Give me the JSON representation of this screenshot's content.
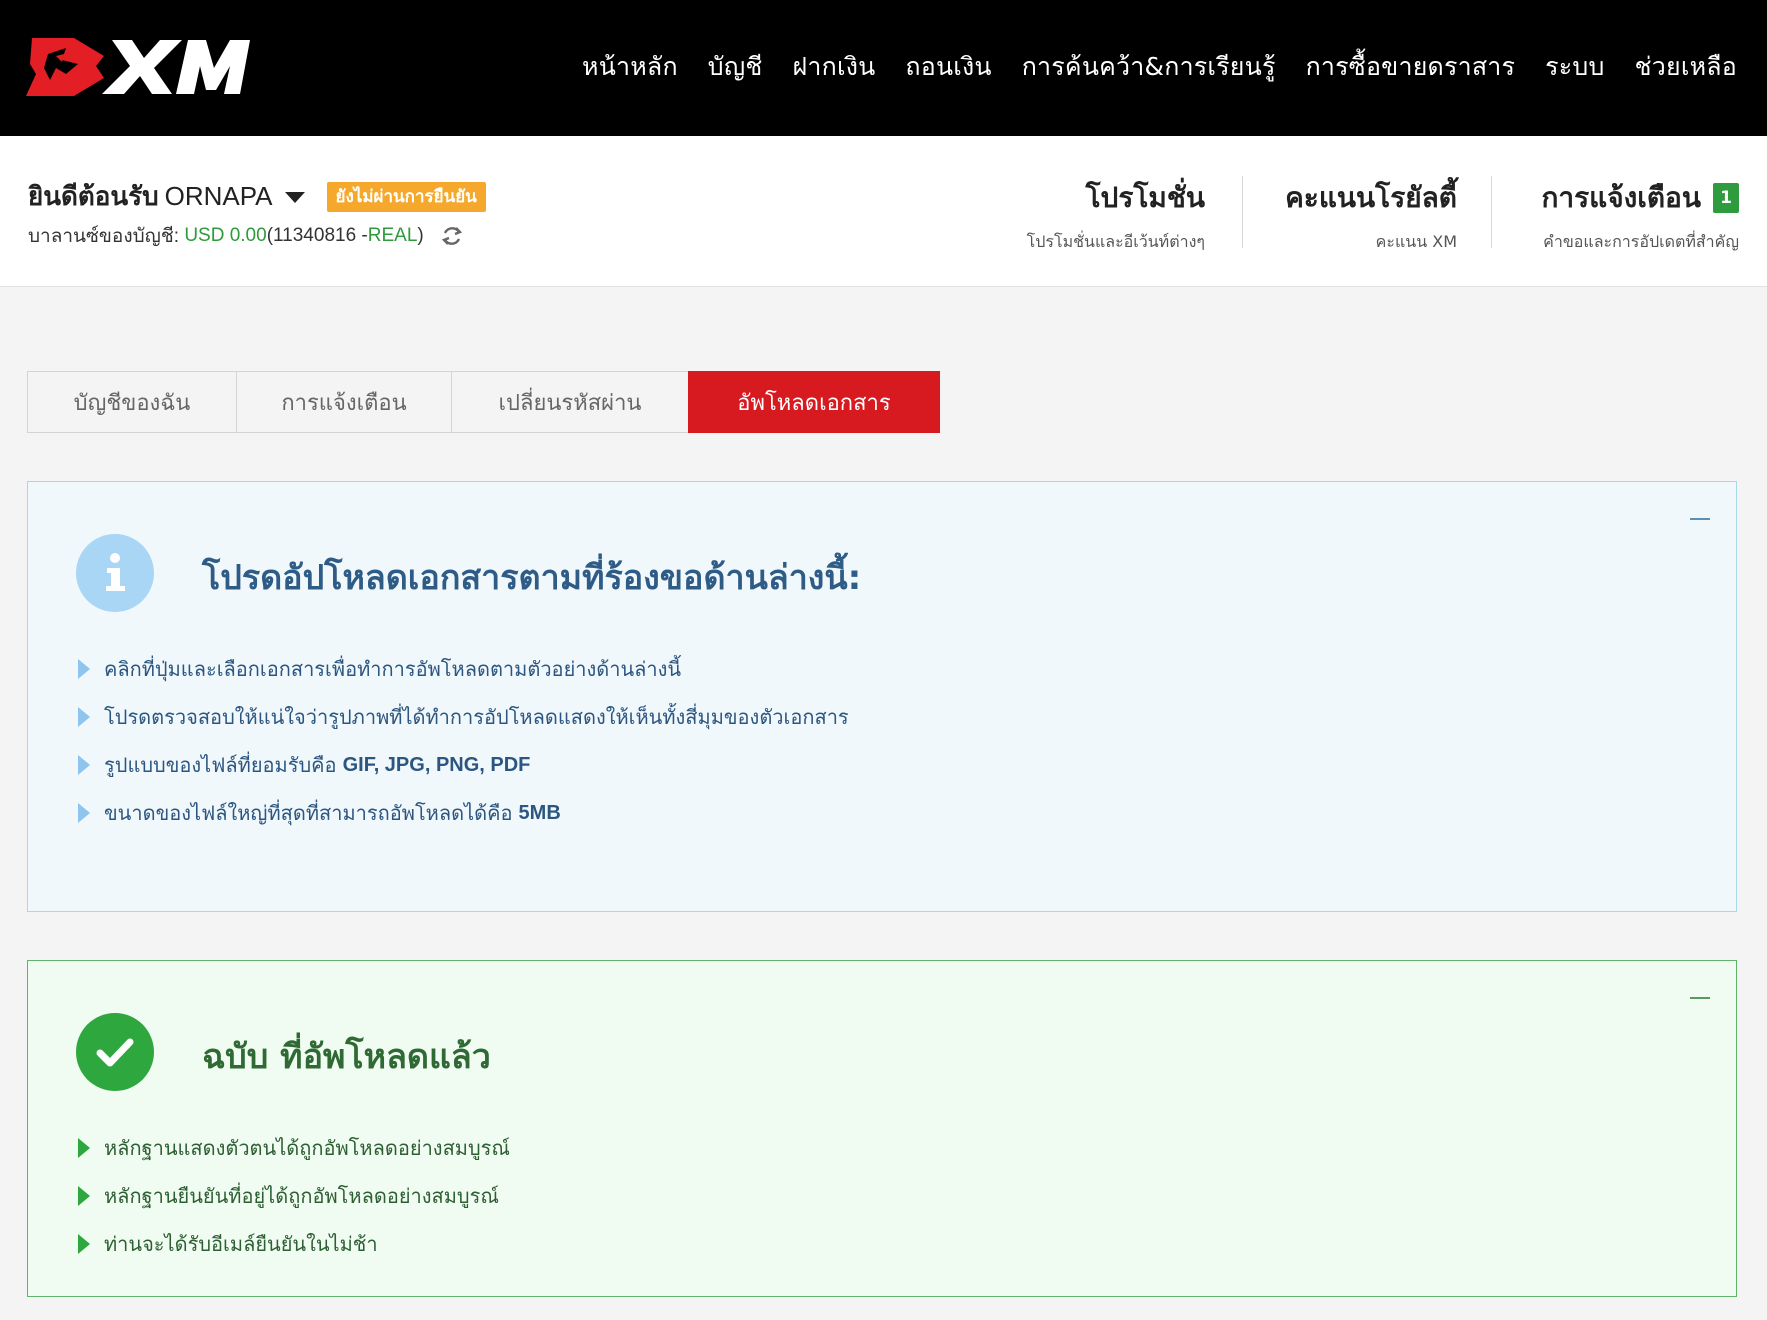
{
  "brand": {
    "name": "XM",
    "red": "#e31e24"
  },
  "nav": [
    {
      "label": "หน้าหลัก"
    },
    {
      "label": "บัญชี"
    },
    {
      "label": "ฝากเงิน"
    },
    {
      "label": "ถอนเงิน"
    },
    {
      "label": "การค้นคว้า&การเรียนรู้"
    },
    {
      "label": "การซื้อขายดราสาร"
    },
    {
      "label": "ระบบ"
    },
    {
      "label": "ช่วยเหลือ"
    }
  ],
  "welcome": {
    "greeting": "ยินดีต้อนรับ",
    "name": "ORNAPA",
    "status_badge": "ยังไม่ผ่านการยืนยัน",
    "balance_label": "บาลานซ์ของบัญชี:",
    "balance_value": "USD 0.00",
    "account_open": " (11340816 - ",
    "account_type": "REAL",
    "account_close": ")"
  },
  "quick_links": [
    {
      "title": "โปรโมชั่น",
      "subtitle": "โปรโมชั่นและอีเว้นท์ต่างๆ"
    },
    {
      "title": "คะแนนโรยัลตี้",
      "subtitle": "คะแนน XM"
    },
    {
      "title": "การแจ้งเตือน",
      "subtitle": "คำขอและการอัปเดตที่สำคัญ",
      "badge": "1"
    }
  ],
  "tabs": [
    {
      "label": "บัญชีของฉัน",
      "active": false
    },
    {
      "label": "การแจ้งเตือน",
      "active": false
    },
    {
      "label": "เปลี่ยนรหัสผ่าน",
      "active": false
    },
    {
      "label": "อัพโหลดเอกสาร",
      "active": true
    }
  ],
  "info_panel": {
    "icon": "info-icon",
    "title": "โปรดอัปโหลดเอกสารตามที่ร้องขอด้านล่างนี้:",
    "items": [
      {
        "text": "คลิกที่ปุ่มและเลือกเอกสารเพื่อทำการอัพโหลดตามตัวอย่างด้านล่างนี้",
        "strong": ""
      },
      {
        "text": "โปรดตรวจสอบให้แน่ใจว่ารูปภาพที่ได้ทำการอัปโหลดแสดงให้เห็นทั้งสี่มุมของตัวเอกสาร",
        "strong": ""
      },
      {
        "text": "รูปแบบของไฟล์ที่ยอมรับคือ",
        "strong": "GIF, JPG, PNG, PDF"
      },
      {
        "text": "ขนาดของไฟล์ใหญ่ที่สุดที่สามารถอัพโหลดได้คือ",
        "strong": "5MB"
      }
    ]
  },
  "done_panel": {
    "icon": "check-icon",
    "title": "ฉบับ ที่อัพโหลดแล้ว",
    "items": [
      {
        "text": "หลักฐานแสดงตัวตนได้ถูกอัพโหลดอย่างสมบูรณ์"
      },
      {
        "text": "หลักฐานยืนยันที่อยู่ได้ถูกอัพโหลดอย่างสมบูรณ์"
      },
      {
        "text": "ท่านจะได้รับอีเมล์ยืนยันในไม่ช้า"
      }
    ]
  }
}
